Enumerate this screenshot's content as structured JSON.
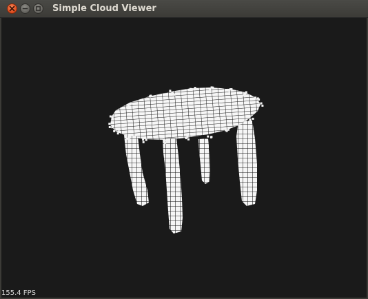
{
  "window": {
    "title": "Simple Cloud Viewer"
  },
  "titlebar_buttons": {
    "close": "close-icon",
    "minimize": "minimize-icon",
    "maximize": "maximize-icon"
  },
  "viewer": {
    "fps_text": "155.4 FPS",
    "background_color": "#1a1a1a",
    "point_color": "#ffffff",
    "object": "point-cloud-table"
  }
}
